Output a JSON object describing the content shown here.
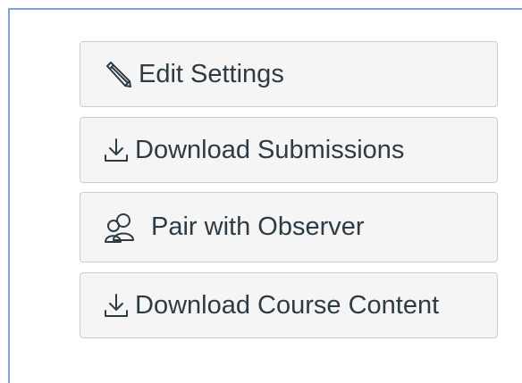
{
  "buttons": {
    "edit_settings": {
      "label": "Edit Settings",
      "icon": "pencil-icon"
    },
    "download_submissions": {
      "label": "Download Submissions",
      "icon": "download-icon"
    },
    "pair_with_observer": {
      "label": "Pair with Observer",
      "icon": "users-icon"
    },
    "download_course_content": {
      "label": "Download Course Content",
      "icon": "download-icon"
    }
  },
  "colors": {
    "button_background": "#f5f5f5",
    "button_border": "#c7cdd1",
    "text": "#2d3b45",
    "panel_border": "#7aa3d3"
  }
}
